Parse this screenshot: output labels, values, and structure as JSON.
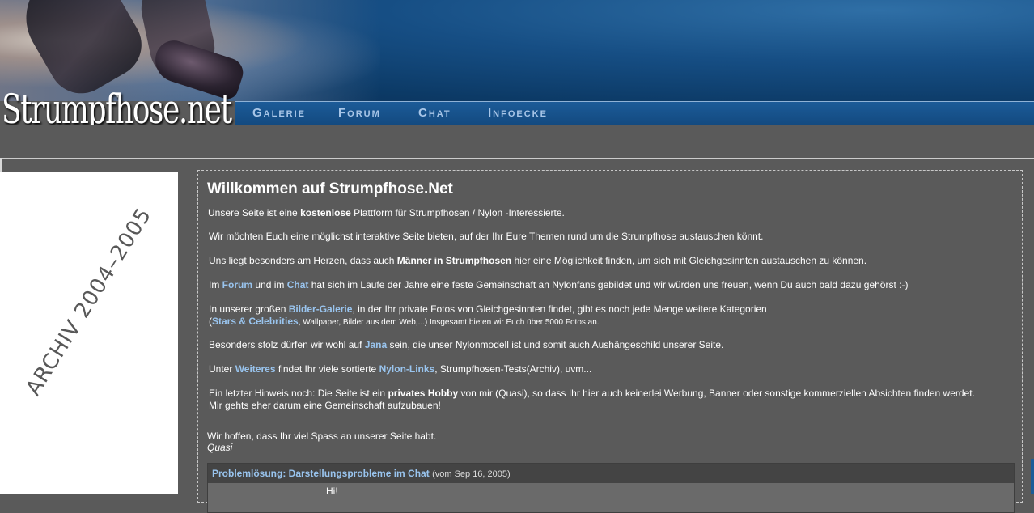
{
  "header": {
    "logo": "Strumpfhose.net",
    "nav": [
      {
        "label": "Galerie"
      },
      {
        "label": "Forum"
      },
      {
        "label": "Chat"
      },
      {
        "label": "Infoecke"
      }
    ]
  },
  "sidebar": {
    "archive_label": "ARCHIV 2004–2005"
  },
  "main": {
    "title": "Willkommen auf Strumpfhose.Net",
    "p1": {
      "a": "Unsere Seite ist eine ",
      "b": "kostenlose",
      "c": " Plattform für Strumpfhosen / Nylon -Interessierte."
    },
    "p2": "Wir möchten Euch eine möglichst interaktive Seite bieten, auf der Ihr Eure Themen rund um die Strumpfhose austauschen könnt.",
    "p3": {
      "a": "Uns liegt besonders am Herzen, dass auch ",
      "b": "Männer in Strumpfhosen",
      "c": " hier eine Möglichkeit finden, um sich mit Gleichgesinnten austauschen zu können."
    },
    "p4": {
      "a": "Im ",
      "forum": "Forum",
      "b": " und im ",
      "chat": "Chat",
      "c": " hat sich im Laufe der Jahre eine feste Gemeinschaft an Nylonfans gebildet und wir würden uns freuen, wenn Du auch bald dazu gehörst :-)"
    },
    "p5": {
      "a": "In unserer großen ",
      "galerie": "Bilder-Galerie",
      "b": ", in der Ihr private Fotos von Gleichgesinnten findet, gibt es noch jede Menge weitere Kategorien",
      "paren_open": "(",
      "stars": "Stars & Celebrities",
      "c": ", Wallpaper, Bilder aus dem Web,...) Insgesamt bieten wir Euch über 5000 Fotos an."
    },
    "p6": {
      "a": "Besonders stolz dürfen wir wohl auf ",
      "jana": "Jana",
      "b": " sein, die unser Nylonmodell ist und somit auch Aushängeschild unserer Seite."
    },
    "p7": {
      "a": "Unter ",
      "weiteres": "Weiteres",
      "b": " findet Ihr viele sortierte ",
      "nylonlinks": "Nylon-Links",
      "c": ", Strumpfhosen-Tests(Archiv), uvm..."
    },
    "p8": {
      "a": "Ein letzter Hinweis noch: Die Seite ist ein ",
      "b": "privates Hobby",
      "c": " von mir (Quasi), so dass Ihr hier auch keinerlei Werbung, Banner oder sonstige kommerziellen Absichten finden werdet. Mir gehts eher darum eine Gemeinschaft aufzubauen!"
    },
    "closing": "Wir hoffen, dass Ihr viel Spass an unserer Seite habt.",
    "signature": "Quasi"
  },
  "news": {
    "title": "Problemlösung: Darstellungsprobleme im Chat",
    "date": "(vom Sep 16, 2005)",
    "body": "Hi!"
  },
  "colors": {
    "background": "#5a5a5a",
    "link": "#99c4ee",
    "header_blue": "#164e84"
  }
}
